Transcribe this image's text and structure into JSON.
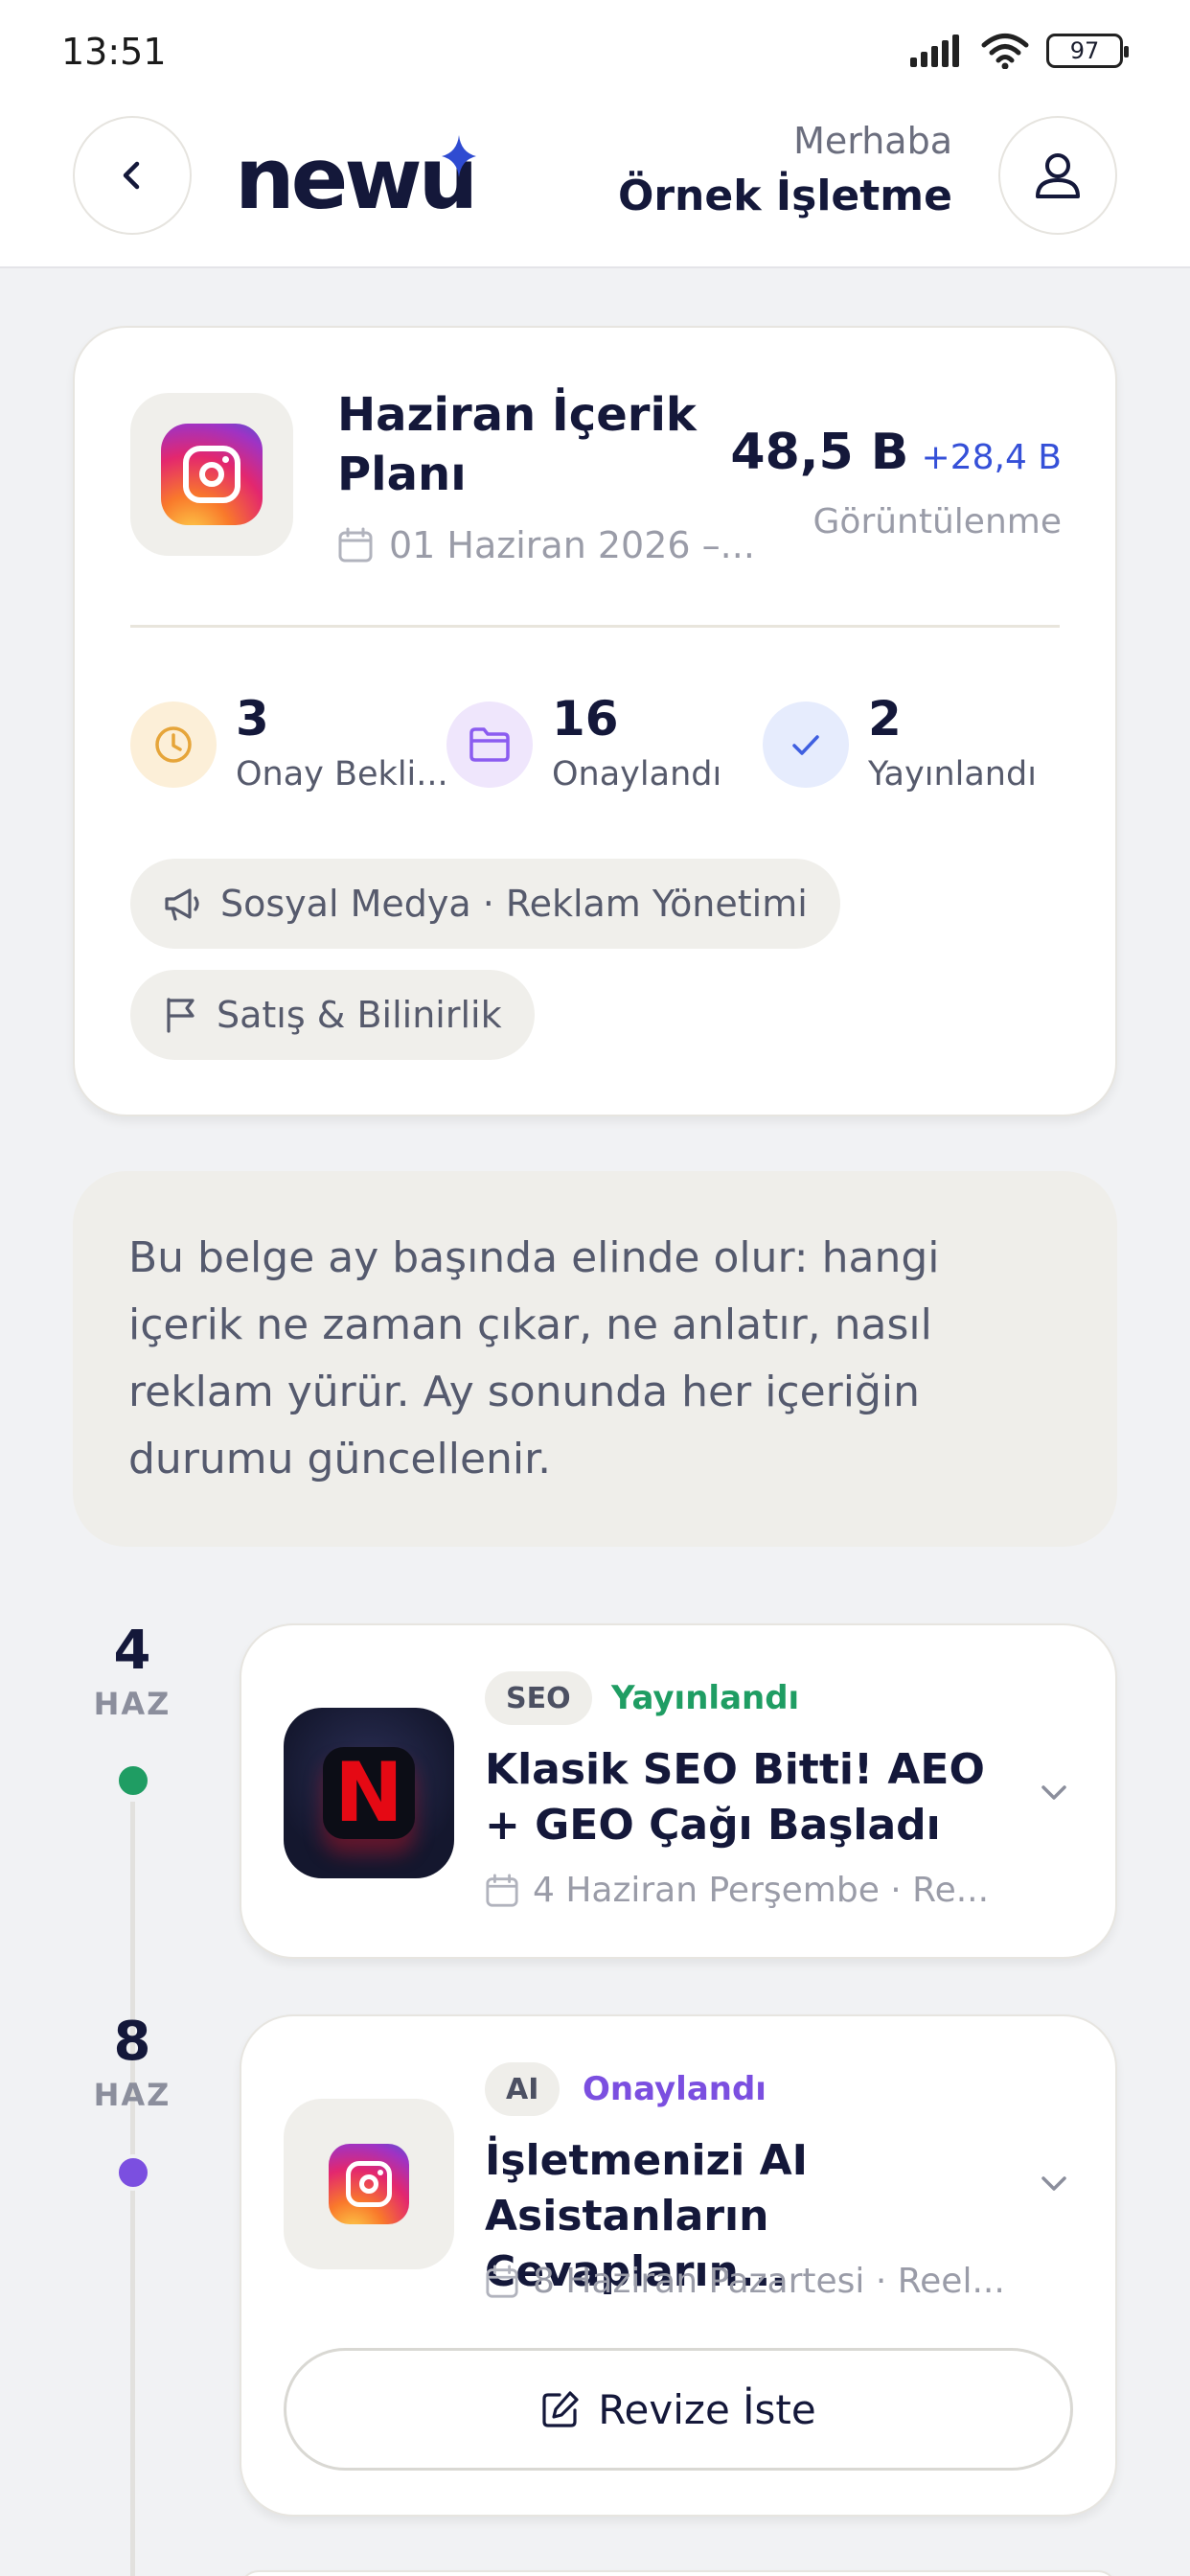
{
  "status_bar": {
    "time": "13:51",
    "battery": "97"
  },
  "header": {
    "logo": "newu",
    "greeting": "Merhaba",
    "business_name": "Örnek İşletme"
  },
  "summary": {
    "title": "Haziran İçerik Planı",
    "date": "01 Haziran 2026 –...",
    "views_value": "48,5 B",
    "views_delta": "+28,4 B",
    "views_label": "Görüntülenme",
    "stats": [
      {
        "value": "3",
        "label": "Onay Bekli...",
        "icon": "clock-icon"
      },
      {
        "value": "16",
        "label": "Onaylandı",
        "icon": "folder-icon"
      },
      {
        "value": "2",
        "label": "Yayınlandı",
        "icon": "check-icon"
      }
    ],
    "chips": [
      {
        "label": "Sosyal Medya · Reklam Yönetimi",
        "icon": "megaphone-icon"
      },
      {
        "label": "Satış & Bilinirlik",
        "icon": "flag-icon"
      }
    ]
  },
  "note": "Bu belge ay başında elinde olur: hangi içerik ne zaman çıkar, ne anlatır, nasıl reklam yürür. Ay sonunda her içeriğin durumu güncellenir.",
  "timeline": [
    {
      "day": "4",
      "month": "HAZ",
      "tag": "SEO",
      "status": "Yayınlandı",
      "status_color": "#1f9d63",
      "title": "Klasik SEO Bitti! AEO + GEO Çağı Başladı",
      "meta": "4 Haziran Perşembe · Re...",
      "thumb": "netflix-logo"
    },
    {
      "day": "8",
      "month": "HAZ",
      "tag": "AI",
      "status": "Onaylandı",
      "status_color": "#7b4fe0",
      "title": "İşletmenizi AI Asistanların Cevapların...",
      "meta": "8 Haziran Pazartesi · Reel...",
      "thumb": "instagram-logo",
      "action": "Revize İste"
    }
  ],
  "colors": {
    "brand_navy": "#14183a",
    "accent_blue": "#3550d8",
    "published_green": "#1f9d63",
    "approved_purple": "#7b4fe0",
    "pending_orange": "#e6a53a"
  }
}
